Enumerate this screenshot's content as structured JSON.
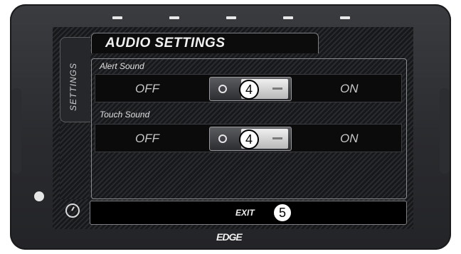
{
  "header": {
    "title": "AUDIO SETTINGS"
  },
  "sidebar": {
    "tab_label": "SETTINGS"
  },
  "sections": [
    {
      "label": "Alert Sound",
      "off_label": "OFF",
      "on_label": "ON",
      "callout": "4"
    },
    {
      "label": "Touch Sound",
      "off_label": "OFF",
      "on_label": "ON",
      "callout": "4"
    }
  ],
  "footer": {
    "exit_label": "EXIT",
    "callout": "5"
  },
  "device": {
    "brand": "EDGE"
  },
  "colors": {
    "screen_bg": "#111214",
    "text": "#f2f2f2",
    "bezel": "#2a2b2e"
  }
}
